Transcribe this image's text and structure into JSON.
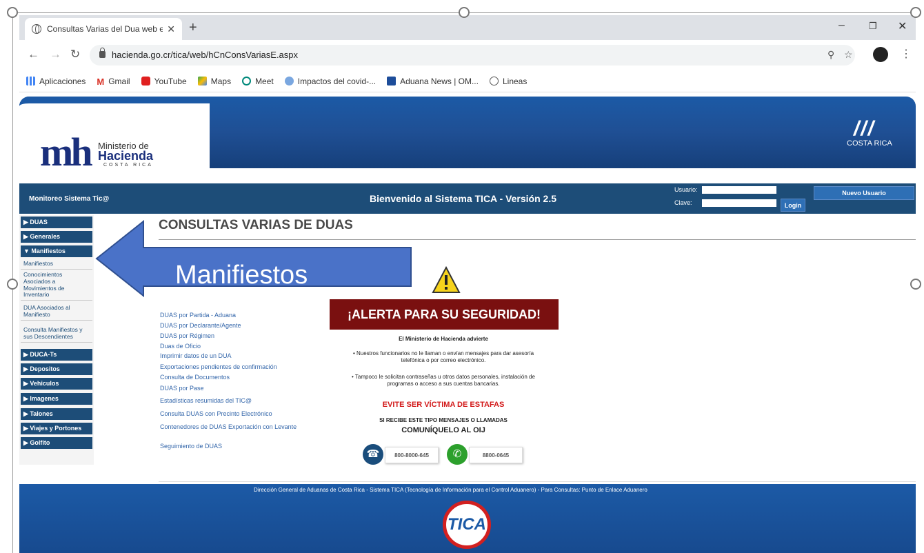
{
  "browser": {
    "tab_title": "Consultas Varias del Dua web ext",
    "url": "hacienda.go.cr/tica/web/hCnConsVariasE.aspx",
    "bookmarks": [
      "Aplicaciones",
      "Gmail",
      "YouTube",
      "Maps",
      "Meet",
      "Impactos del covid-...",
      "Aduana News | OM...",
      "Lineas"
    ]
  },
  "header": {
    "logo_main": "mh",
    "logo_line1": "Ministerio de",
    "logo_line2": "Hacienda",
    "logo_line3": "COSTA RICA",
    "cr_text": "COSTA RICA"
  },
  "welcome": {
    "left": "Monitoreo Sistema Tic@",
    "center": "Bienvenido al Sistema TICA - Versión 2.5",
    "usuario_label": "Usuario:",
    "clave_label": "Clave:",
    "login_label": "Login",
    "new_user_label": "Nuevo Usuario"
  },
  "sidebar": {
    "duas": "▶ DUAS",
    "generales": "▶ Generales",
    "manifiestos": "▼ Manifiestos",
    "sub1": "Manifiestos",
    "sub2": "Conocimientos Asociados a Movimientos de Inventario",
    "sub3": "DUA Asociados al Manifiesto",
    "sub4": "Consulta Manifiestos y sus Descendientes",
    "ducats": "▶ DUCA-Ts",
    "depositos": "▶ Depositos",
    "vehiculos": "▶ Vehiculos",
    "imagenes": "▶ Imagenes",
    "talones": "▶ Talones",
    "viajes": "▶ Viajes y Portones",
    "golfito": "▶ Golfito"
  },
  "main": {
    "title": "CONSULTAS VARIAS DE DUAS",
    "links": [
      "DUAS por Partida - Aduana",
      "DUAS por Declarante/Agente",
      "DUAS por Régimen",
      "Duas de Oficio",
      "Imprimir datos de un DUA",
      "Exportaciones pendientes de confirmación",
      "Consulta de Documentos",
      "DUAS por Pase",
      "Estadísticas resumidas del TIC@",
      "Consulta DUAS con Precinto Electrónico",
      "Contenedores de DUAS Exportación con Levante",
      "Seguimiento de DUAS"
    ]
  },
  "alert": {
    "banner": "¡ALERTA PARA SU SEGURIDAD!",
    "line1": "El Ministerio de Hacienda advierte",
    "line2": "• Nuestros funcionarios no le llaman o envían mensajes para dar asesoría telefónica o por correo electrónico.",
    "line3": "• Tampoco le solicitan contraseñas u otros datos personales, instalación de programas o acceso a sus cuentas bancarias.",
    "line4": "EVITE SER VÍCTIMA DE ESTAFAS",
    "line5": "SI RECIBE ESTE TIPO MENSAJES O LLAMADAS",
    "line6": "COMUNÍQUELO AL OIJ",
    "phone1": "800-8000-645",
    "phone2": "8800-0645"
  },
  "footer": {
    "text": "Dirección General de Aduanas de Costa Rica - Sistema TICA (Tecnología de Información para el Control Aduanero) - Para Consultas:  Punto de Enlace Aduanero",
    "logo": "TICA"
  },
  "overlay": {
    "label": "Manifiestos"
  }
}
